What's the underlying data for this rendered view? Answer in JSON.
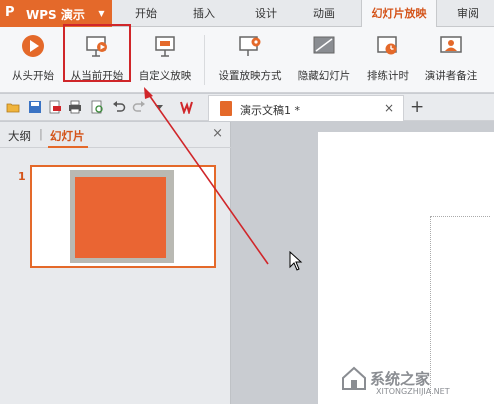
{
  "app": {
    "name": "WPS 演示",
    "logo_glyph": "P",
    "brand_color": "#e4692a"
  },
  "menu": {
    "tabs": [
      "开始",
      "插入",
      "设计",
      "动画",
      "幻灯片放映",
      "审阅"
    ],
    "active_tab": "幻灯片放映"
  },
  "ribbon": {
    "buttons": [
      {
        "label": "从头开始",
        "icon": "play-circle-icon"
      },
      {
        "label": "从当前开始",
        "icon": "play-from-current-icon"
      },
      {
        "label": "自定义放映",
        "icon": "custom-show-icon"
      },
      {
        "label": "设置放映方式",
        "icon": "setup-show-icon"
      },
      {
        "label": "隐藏幻灯片",
        "icon": "hide-slide-icon"
      },
      {
        "label": "排练计时",
        "icon": "rehearse-timing-icon"
      },
      {
        "label": "演讲者备注",
        "icon": "speaker-notes-icon"
      }
    ],
    "highlighted": "从当前开始",
    "highlight_color": "#d0262a"
  },
  "document": {
    "tab_title": "演示文稿1 *",
    "close_glyph": "×",
    "new_tab_glyph": "+"
  },
  "panel": {
    "tabs": [
      "大纲",
      "幻灯片"
    ],
    "active_tab": "幻灯片",
    "close_glyph": "×",
    "slide_number": "1"
  },
  "watermark": {
    "text": "系统之家",
    "url": "XITONGZHIJIA.NET"
  }
}
